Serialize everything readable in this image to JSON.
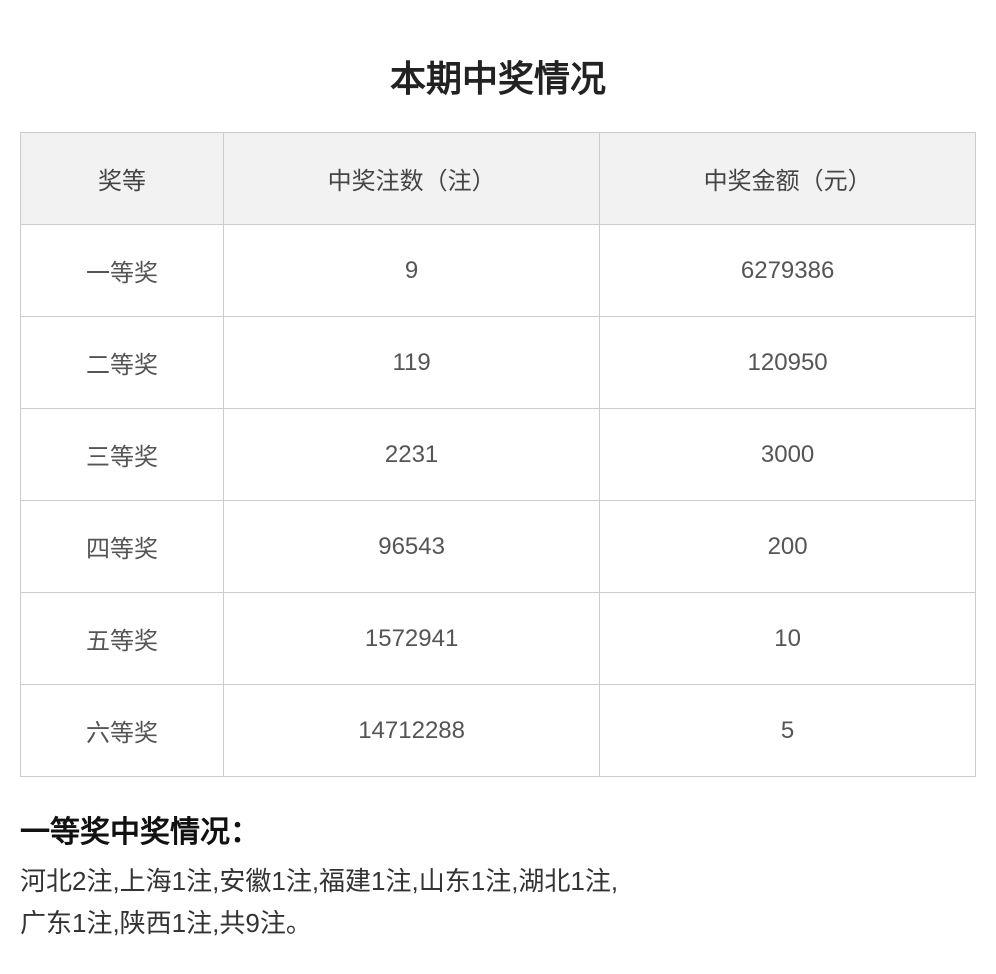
{
  "page": {
    "title": "本期中奖情况"
  },
  "table": {
    "headers": [
      "奖等",
      "中奖注数（注）",
      "中奖金额（元）"
    ],
    "rows": [
      {
        "level": "一等奖",
        "count": "9",
        "amount": "6279386"
      },
      {
        "level": "二等奖",
        "count": "119",
        "amount": "120950"
      },
      {
        "level": "三等奖",
        "count": "2231",
        "amount": "3000"
      },
      {
        "level": "四等奖",
        "count": "96543",
        "amount": "200"
      },
      {
        "level": "五等奖",
        "count": "1572941",
        "amount": "10"
      },
      {
        "level": "六等奖",
        "count": "14712288",
        "amount": "5"
      }
    ]
  },
  "prize_section": {
    "title": "一等奖中奖情况：",
    "detail_line1": "河北2注,上海1注,安徽1注,福建1注,山东1注,湖北1注,",
    "detail_line2": "广东1注,陕西1注,共9注。"
  }
}
